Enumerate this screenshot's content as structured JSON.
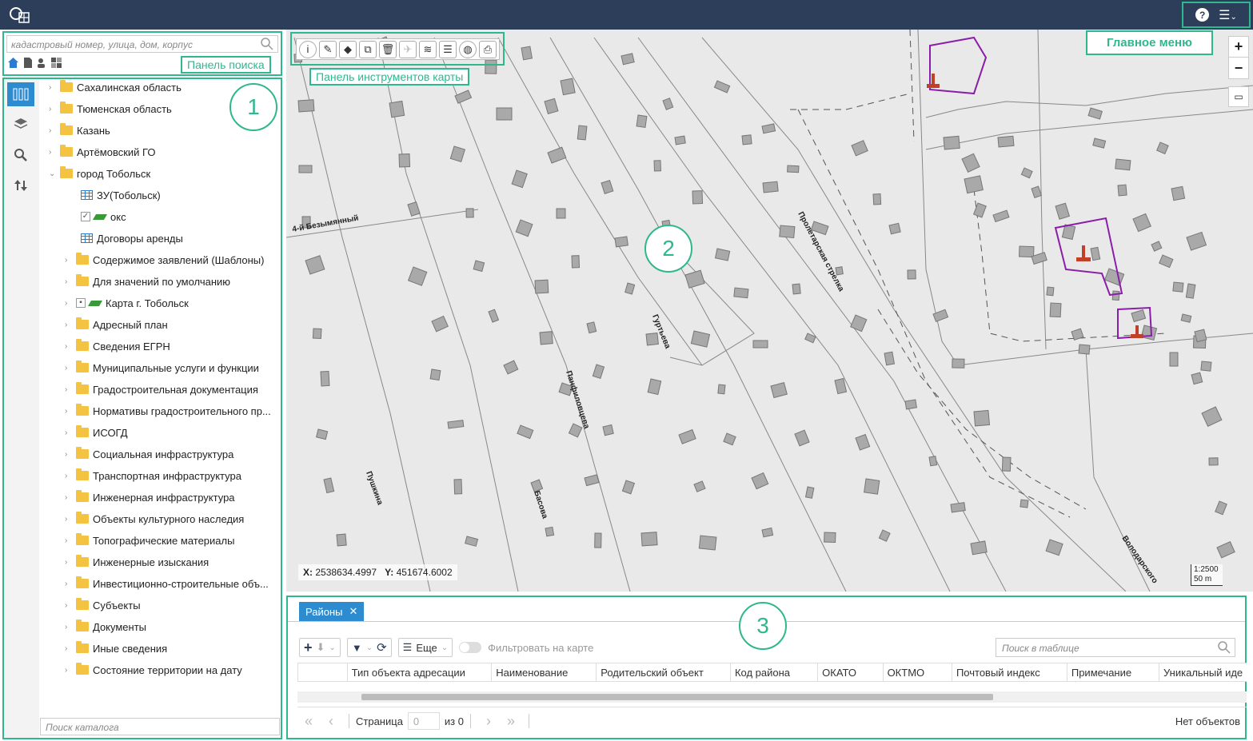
{
  "header": {
    "help_icon": "?",
    "menu_icon": "☰"
  },
  "annotations": {
    "main_menu": "Главное меню",
    "search_panel": "Панель поиска",
    "map_toolbar": "Панель  инструментов карты",
    "num1": "1",
    "num2": "2",
    "num3": "3"
  },
  "search": {
    "placeholder": "кадастровый номер, улица, дом, корпус"
  },
  "tree": {
    "items": [
      {
        "label": "Сахалинская область",
        "type": "folder",
        "level": 0
      },
      {
        "label": "Тюменская область",
        "type": "folder",
        "level": 0
      },
      {
        "label": "Казань",
        "type": "folder",
        "level": 0
      },
      {
        "label": "Артёмовский ГО",
        "type": "folder",
        "level": 0
      },
      {
        "label": "город Тобольск",
        "type": "folder-open",
        "level": 0
      },
      {
        "label": "ЗУ(Тобольск)",
        "type": "table",
        "level": 1
      },
      {
        "label": "окс",
        "type": "layer",
        "level": 1
      },
      {
        "label": "Договоры аренды",
        "type": "table",
        "level": 1
      },
      {
        "label": "Содержимое заявлений (Шаблоны)",
        "type": "folder",
        "level": 1
      },
      {
        "label": "Для значений по умолчанию",
        "type": "folder",
        "level": 1
      },
      {
        "label": "Карта г. Тобольск",
        "type": "map",
        "level": 1
      },
      {
        "label": "Адресный план",
        "type": "folder",
        "level": 1
      },
      {
        "label": "Сведения ЕГРН",
        "type": "folder",
        "level": 1
      },
      {
        "label": "Муниципальные услуги и функции",
        "type": "folder",
        "level": 1
      },
      {
        "label": "Градостроительная документация",
        "type": "folder",
        "level": 1
      },
      {
        "label": "Нормативы градостроительного пр...",
        "type": "folder",
        "level": 1
      },
      {
        "label": "ИСОГД",
        "type": "folder",
        "level": 1
      },
      {
        "label": "Социальная инфраструктура",
        "type": "folder",
        "level": 1
      },
      {
        "label": "Транспортная инфраструктура",
        "type": "folder",
        "level": 1
      },
      {
        "label": "Инженерная инфраструктура",
        "type": "folder",
        "level": 1
      },
      {
        "label": "Объекты культурного наследия",
        "type": "folder",
        "level": 1
      },
      {
        "label": "Топографические материалы",
        "type": "folder",
        "level": 1
      },
      {
        "label": "Инженерные изыскания",
        "type": "folder",
        "level": 1
      },
      {
        "label": "Инвестиционно-строительные объ...",
        "type": "folder",
        "level": 1
      },
      {
        "label": "Субъекты",
        "type": "folder",
        "level": 1
      },
      {
        "label": "Документы",
        "type": "folder",
        "level": 1
      },
      {
        "label": "Иные сведения",
        "type": "folder",
        "level": 1
      },
      {
        "label": "Состояние территории на дату",
        "type": "folder",
        "level": 1
      }
    ],
    "catalog_search_placeholder": "Поиск каталога"
  },
  "map": {
    "streets": [
      "4-й Безымянный",
      "Пролетарская стрелка",
      "Гуртьева",
      "Панфиловцева",
      "Пушкина",
      "Басова",
      "Володарского"
    ],
    "coords": {
      "x_label": "X:",
      "x_value": "2538634.4997",
      "y_label": "Y:",
      "y_value": "451674.6002"
    },
    "scale": {
      "ratio": "1:2500",
      "distance": "50 m"
    },
    "zoom_in": "+",
    "zoom_out": "−"
  },
  "table_panel": {
    "tab_label": "Районы",
    "more_label": "Еще",
    "filter_on_map_label": "Фильтровать на карте",
    "search_placeholder": "Поиск в таблице",
    "columns": [
      "Тип объекта адресации",
      "Наименование",
      "Родительский объект",
      "Код района",
      "ОКАТО",
      "ОКТМО",
      "Почтовый индекс",
      "Примечание",
      "Уникальный иде"
    ],
    "pager": {
      "page_label": "Страница",
      "page_value": "0",
      "of_label": "из 0",
      "no_objects": "Нет объектов"
    }
  }
}
